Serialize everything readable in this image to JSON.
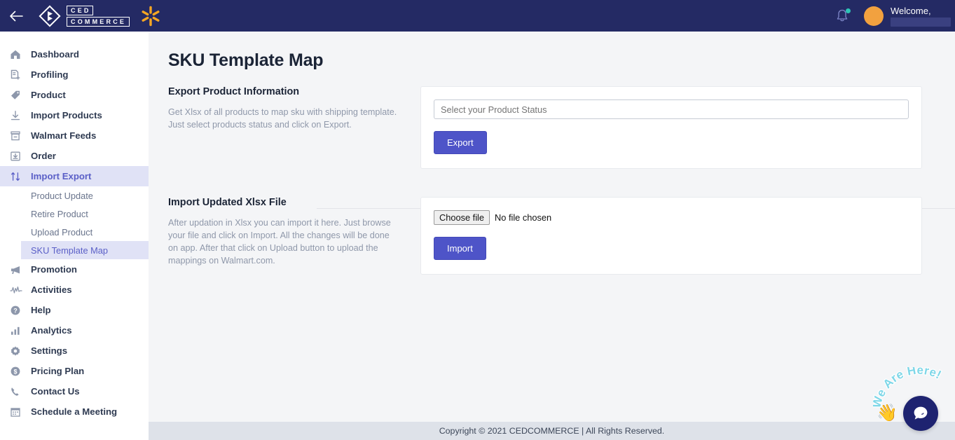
{
  "topbar": {
    "back_icon": "back-arrow-icon",
    "brand_line1": "CED",
    "brand_line2": "COMMERCE",
    "marketplace_icon": "walmart-spark-icon",
    "bell_icon": "notification-bell-icon",
    "welcome_text": "Welcome,",
    "avatar": "user-avatar",
    "bg_color": "#242a64",
    "spark_color": "#f5a623",
    "bell_dot_color": "#2ec4b6"
  },
  "sidebar": {
    "items": [
      {
        "label": "Dashboard",
        "icon": "home-icon",
        "active": false
      },
      {
        "label": "Profiling",
        "icon": "file-plus-icon",
        "active": false
      },
      {
        "label": "Product",
        "icon": "tag-icon",
        "active": false
      },
      {
        "label": "Import Products",
        "icon": "download-icon",
        "active": false
      },
      {
        "label": "Walmart Feeds",
        "icon": "archive-box-icon",
        "active": false
      },
      {
        "label": "Order",
        "icon": "inbox-download-icon",
        "active": false
      },
      {
        "label": "Import Export",
        "icon": "up-down-arrows-icon",
        "active": true
      }
    ],
    "sub_items": [
      {
        "label": "Product Update",
        "active": false
      },
      {
        "label": "Retire Product",
        "active": false
      },
      {
        "label": "Upload Product",
        "active": false
      },
      {
        "label": "SKU Template Map",
        "active": true
      }
    ],
    "items_lower": [
      {
        "label": "Promotion",
        "icon": "megaphone-icon",
        "active": false
      },
      {
        "label": "Activities",
        "icon": "activity-pulse-icon",
        "active": false
      },
      {
        "label": "Help",
        "icon": "question-circle-icon",
        "active": false
      },
      {
        "label": "Analytics",
        "icon": "bar-chart-icon",
        "active": false
      },
      {
        "label": "Settings",
        "icon": "gear-icon",
        "active": false
      },
      {
        "label": "Pricing Plan",
        "icon": "dollar-circle-icon",
        "active": false
      },
      {
        "label": "Contact Us",
        "icon": "phone-icon",
        "active": false
      },
      {
        "label": "Schedule a Meeting",
        "icon": "calendar-icon",
        "active": false
      }
    ],
    "active_bg": "#e0e2f6",
    "active_color": "#5a5fc7"
  },
  "main": {
    "page_title": "SKU Template Map",
    "export_section": {
      "heading": "Export Product Information",
      "description": "Get Xlsx of all products to map sku with shipping template. Just select products status and click on Export.",
      "select_placeholder": "Select your Product Status",
      "select_value": "",
      "button_label": "Export"
    },
    "import_section": {
      "heading": "Import Updated Xlsx File",
      "description": "After updation in Xlsx you can import it here. Just browse your file and click on Import. All the changes will be done on app. After that click on Upload button to upload the mappings on Walmart.com.",
      "choose_file_label": "Choose file",
      "file_status": "No file chosen",
      "button_label": "Import"
    },
    "primary_button_color": "#4e54c8",
    "content_bg": "#f4f5f7"
  },
  "footer": {
    "text": "Copyright © 2021 CEDCOMMERCE | All Rights Reserved.",
    "bg_color": "#dee2e9"
  },
  "chat_widget": {
    "badge_text": "We Are Here!",
    "hand_icon": "waving-hand-icon",
    "bubble_icon": "chat-bubble-icon",
    "badge_color": "#7fd7e8",
    "bubble_bg": "#1e2370"
  }
}
